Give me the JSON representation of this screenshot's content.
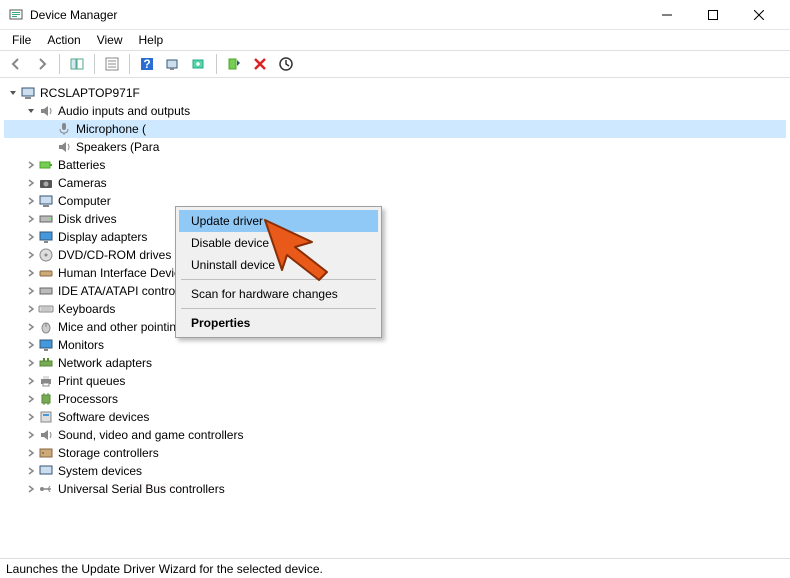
{
  "window": {
    "title": "Device Manager"
  },
  "menu": {
    "file": "File",
    "action": "Action",
    "view": "View",
    "help": "Help"
  },
  "tree": {
    "root": "RCSLAPTOP971F",
    "audio_category": "Audio inputs and outputs",
    "microphone": "Microphone (",
    "speakers": "Speakers (Para",
    "batteries": "Batteries",
    "cameras": "Cameras",
    "computer": "Computer",
    "disk_drives": "Disk drives",
    "display_adapters": "Display adapters",
    "dvd": "DVD/CD-ROM drives",
    "hid": "Human Interface Devices",
    "ide": "IDE ATA/ATAPI controllers",
    "keyboards": "Keyboards",
    "mice": "Mice and other pointing devices",
    "monitors": "Monitors",
    "network": "Network adapters",
    "print_queues": "Print queues",
    "processors": "Processors",
    "software": "Software devices",
    "sound": "Sound, video and game controllers",
    "storage": "Storage controllers",
    "system": "System devices",
    "usb": "Universal Serial Bus controllers"
  },
  "context_menu": {
    "update_driver": "Update driver",
    "disable_device": "Disable device",
    "uninstall_device": "Uninstall device",
    "scan": "Scan for hardware changes",
    "properties": "Properties"
  },
  "status": "Launches the Update Driver Wizard for the selected device."
}
